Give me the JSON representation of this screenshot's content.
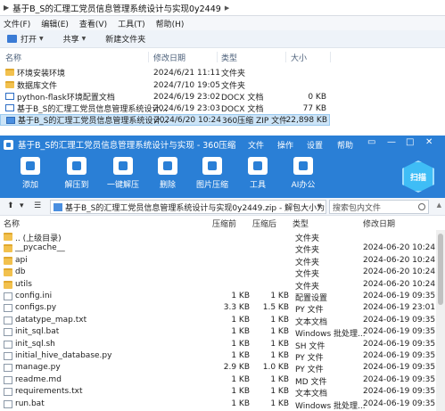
{
  "explorer": {
    "path": "基于B_S的汇理工党员信息管理系统设计与实现0y2449",
    "menu": [
      "文件(F)",
      "编辑(E)",
      "查看(V)",
      "工具(T)",
      "帮助(H)"
    ],
    "toolbar": {
      "open": "打开",
      "share": "共享",
      "new_folder": "新建文件夹"
    },
    "columns": {
      "name": "名称",
      "date": "修改日期",
      "type": "类型",
      "size": "大小"
    },
    "rows": [
      {
        "name": "环境安装环境",
        "date": "2024/6/21 11:11",
        "type": "文件夹",
        "size": "",
        "icon": "folder"
      },
      {
        "name": "数据库文件",
        "date": "2024/7/10 19:05",
        "type": "文件夹",
        "size": "",
        "icon": "folder"
      },
      {
        "name": "python-flask环境配置文档",
        "date": "2024/6/19 23:02",
        "type": "DOCX 文档",
        "size": "0 KB",
        "icon": "doc"
      },
      {
        "name": "基于B_S的汇理工党员信息管理系统设计...",
        "date": "2024/6/19 23:03",
        "type": "DOCX 文档",
        "size": "77 KB",
        "icon": "doc"
      },
      {
        "name": "基于B_S的汇理工党员信息管理系统设计...",
        "date": "2024/6/20 10:24",
        "type": "360压缩 ZIP 文件",
        "size": "22,898 KB",
        "icon": "zip"
      }
    ]
  },
  "zip": {
    "title": "基于B_S的汇理工党员信息管理系统设计与实现 - 360压缩",
    "menu": {
      "file": "文件",
      "ops": "操作",
      "settings": "设置",
      "help": "帮助"
    },
    "toolbar": [
      "添加",
      "解压到",
      "一键解压",
      "删除",
      "图片压缩",
      "工具",
      "AI办公"
    ],
    "scan_label": "扫描",
    "path": "基于B_S的汇理工党员信息管理系统设计与实现0y2449.zip - 解包大小为 50.1",
    "path_suffix": "V",
    "search_placeholder": "搜索包内文件",
    "columns": {
      "name": "名称",
      "before": "压缩前",
      "after": "压缩后",
      "type": "类型",
      "date": "修改日期"
    },
    "rows": [
      {
        "name": ".. (上级目录)",
        "before": "",
        "after": "",
        "type": "文件夹",
        "date": "",
        "icon": "folder"
      },
      {
        "name": "__pycache__",
        "before": "",
        "after": "",
        "type": "文件夹",
        "date": "2024-06-20 10:24",
        "icon": "folder"
      },
      {
        "name": "api",
        "before": "",
        "after": "",
        "type": "文件夹",
        "date": "2024-06-20 10:24",
        "icon": "folder"
      },
      {
        "name": "db",
        "before": "",
        "after": "",
        "type": "文件夹",
        "date": "2024-06-20 10:24",
        "icon": "folder"
      },
      {
        "name": "utils",
        "before": "",
        "after": "",
        "type": "文件夹",
        "date": "2024-06-20 10:24",
        "icon": "folder"
      },
      {
        "name": "config.ini",
        "before": "1 KB",
        "after": "1 KB",
        "type": "配置设置",
        "date": "2024-06-19 09:35",
        "icon": "file"
      },
      {
        "name": "configs.py",
        "before": "3.3 KB",
        "after": "1.5 KB",
        "type": "PY 文件",
        "date": "2024-06-19 23:01",
        "icon": "file"
      },
      {
        "name": "datatype_map.txt",
        "before": "1 KB",
        "after": "1 KB",
        "type": "文本文档",
        "date": "2024-06-19 09:35",
        "icon": "file"
      },
      {
        "name": "init_sql.bat",
        "before": "1 KB",
        "after": "1 KB",
        "type": "Windows 批处理...",
        "date": "2024-06-19 09:35",
        "icon": "file"
      },
      {
        "name": "init_sql.sh",
        "before": "1 KB",
        "after": "1 KB",
        "type": "SH 文件",
        "date": "2024-06-19 09:35",
        "icon": "file"
      },
      {
        "name": "initial_hive_database.py",
        "before": "1 KB",
        "after": "1 KB",
        "type": "PY 文件",
        "date": "2024-06-19 09:35",
        "icon": "file"
      },
      {
        "name": "manage.py",
        "before": "2.9 KB",
        "after": "1.0 KB",
        "type": "PY 文件",
        "date": "2024-06-19 09:35",
        "icon": "file"
      },
      {
        "name": "readme.md",
        "before": "1 KB",
        "after": "1 KB",
        "type": "MD 文件",
        "date": "2024-06-19 09:35",
        "icon": "file"
      },
      {
        "name": "requirements.txt",
        "before": "1 KB",
        "after": "1 KB",
        "type": "文本文档",
        "date": "2024-06-19 09:35",
        "icon": "file"
      },
      {
        "name": "run.bat",
        "before": "1 KB",
        "after": "1 KB",
        "type": "Windows 批处理...",
        "date": "2024-06-19 09:35",
        "icon": "file"
      }
    ]
  },
  "colors": {
    "accent": "#2a7fd6",
    "selected_row": "#cce4f7",
    "folder": "#f2c14e"
  }
}
